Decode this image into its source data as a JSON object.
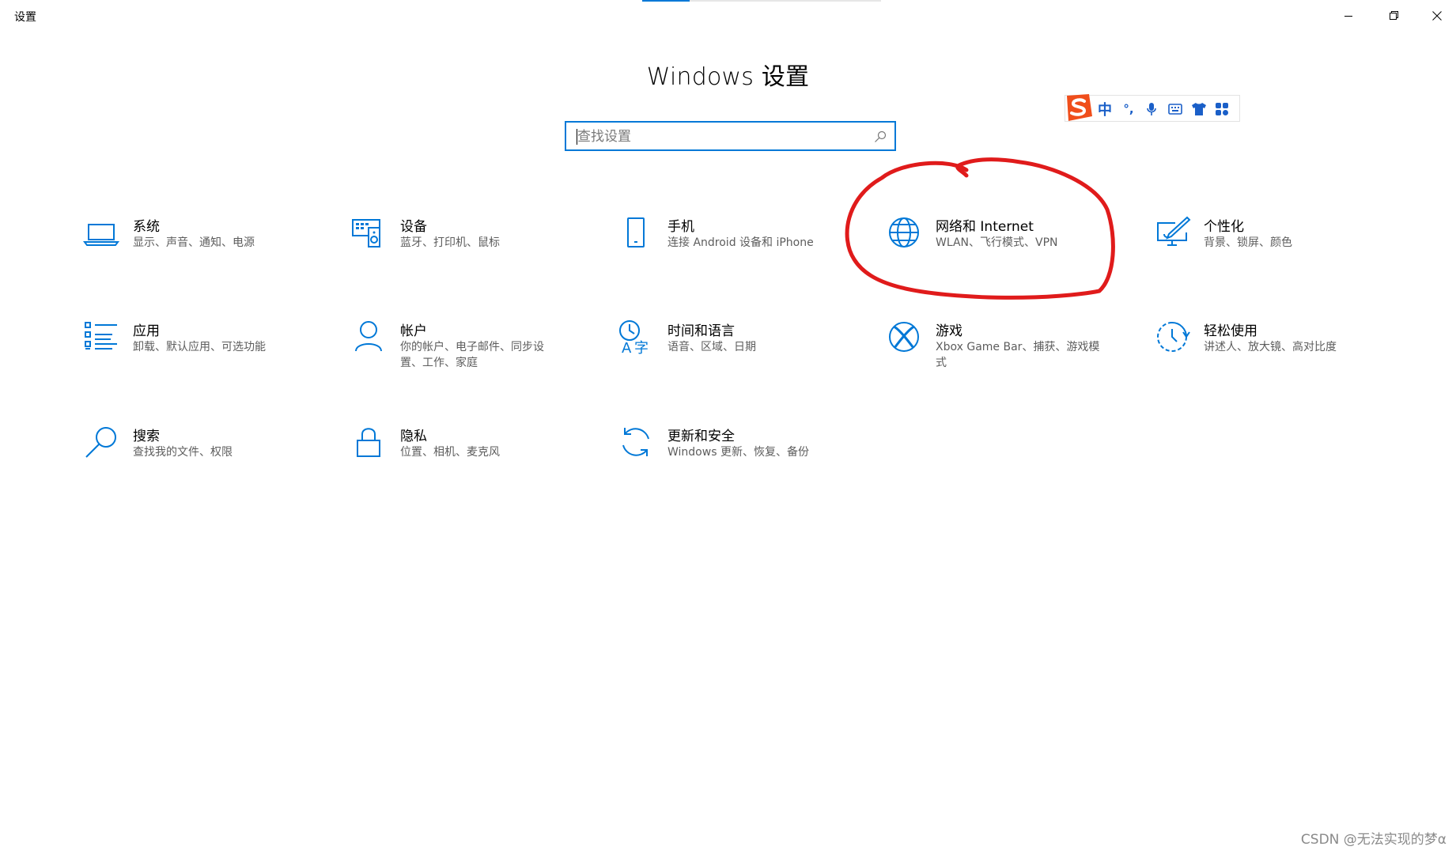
{
  "window": {
    "title": "设置",
    "heading": "Windows 设置"
  },
  "search": {
    "value": "",
    "placeholder": "查找设置"
  },
  "ime": {
    "items": [
      "中",
      "°,",
      "mic",
      "keyboard",
      "shirt",
      "apps"
    ]
  },
  "tiles": [
    {
      "name": "系统",
      "desc": "显示、声音、通知、电源",
      "icon": "laptop-icon"
    },
    {
      "name": "设备",
      "desc": "蓝牙、打印机、鼠标",
      "icon": "devices-icon"
    },
    {
      "name": "手机",
      "desc": "连接 Android 设备和 iPhone",
      "icon": "phone-icon"
    },
    {
      "name": "网络和 Internet",
      "desc": "WLAN、飞行模式、VPN",
      "icon": "globe-icon"
    },
    {
      "name": "个性化",
      "desc": "背景、锁屏、颜色",
      "icon": "personalization-icon"
    },
    {
      "name": "应用",
      "desc": "卸载、默认应用、可选功能",
      "icon": "apps-list-icon"
    },
    {
      "name": "帐户",
      "desc": "你的帐户、电子邮件、同步设置、工作、家庭",
      "icon": "person-icon"
    },
    {
      "name": "时间和语言",
      "desc": "语音、区域、日期",
      "icon": "time-language-icon"
    },
    {
      "name": "游戏",
      "desc": "Xbox Game Bar、捕获、游戏模式",
      "icon": "xbox-icon"
    },
    {
      "name": "轻松使用",
      "desc": "讲述人、放大镜、高对比度",
      "icon": "ease-of-access-icon"
    },
    {
      "name": "搜索",
      "desc": "查找我的文件、权限",
      "icon": "search-icon"
    },
    {
      "name": "隐私",
      "desc": "位置、相机、麦克风",
      "icon": "lock-icon"
    },
    {
      "name": "更新和安全",
      "desc": "Windows 更新、恢复、备份",
      "icon": "sync-icon"
    }
  ],
  "colors": {
    "accent": "#0078d7",
    "annotation": "#e01b1b",
    "ime_logo": "#f04e1b",
    "ime_icons": "#1a5fc8"
  },
  "watermark": "CSDN @无法实现的梦α"
}
